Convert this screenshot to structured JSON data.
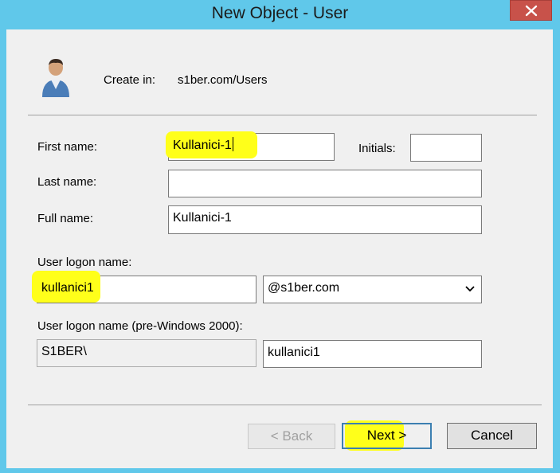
{
  "window": {
    "title": "New Object - User"
  },
  "header": {
    "create_in_label": "Create in:",
    "create_in_path": "s1ber.com/Users"
  },
  "form": {
    "first_name_label": "First name:",
    "first_name_value": "Kullanici-1",
    "initials_label": "Initials:",
    "initials_value": "",
    "last_name_label": "Last name:",
    "last_name_value": "",
    "full_name_label": "Full name:",
    "full_name_value": "Kullanici-1",
    "logon_label": "User logon name:",
    "logon_value": "kullanici1",
    "domain_selected": "@s1ber.com",
    "pre2000_label": "User logon name (pre-Windows 2000):",
    "pre2000_domain": "S1BER\\",
    "pre2000_user": "kullanici1"
  },
  "buttons": {
    "back": "< Back",
    "next": "Next >",
    "cancel": "Cancel"
  },
  "colors": {
    "title_bar": "#60c8ea",
    "close": "#c8524a",
    "highlight": "#ffff1a",
    "default_button_border": "#3c7fb1"
  },
  "icons": {
    "user": "user-icon",
    "close": "close-icon",
    "dropdown": "chevron-down-icon"
  }
}
